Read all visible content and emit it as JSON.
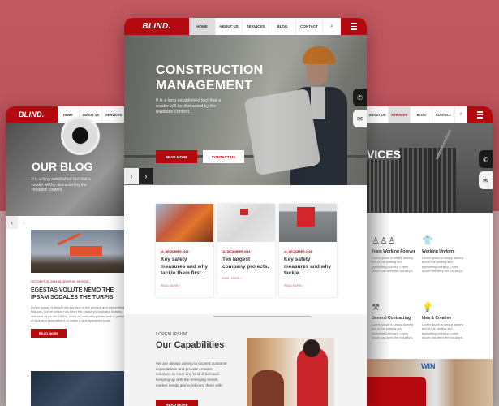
{
  "brand": {
    "logo": "BLIND.",
    "accent": "#b3090f"
  },
  "center": {
    "nav": {
      "items": [
        {
          "label": "HOME",
          "active": true
        },
        {
          "label": "ABOUT US"
        },
        {
          "label": "SERVICES"
        },
        {
          "label": "BLOG"
        },
        {
          "label": "CONTACT"
        }
      ],
      "search_icon": "⌕",
      "menu_icon": "hamburger-icon"
    },
    "hero": {
      "title": "CONSTRUCTION MANAGEMENT",
      "text": "It is a long established fact that a reader will be distracted by the readable content.",
      "primary_button": "READ MORE",
      "secondary_button": "CONTACT US",
      "prev": "‹",
      "next": "›"
    },
    "side_tabs": {
      "phone": "✆",
      "mail": "✉"
    },
    "cards": [
      {
        "date": "11, DECEMBER 2018",
        "title": "Key safety measures and why tackle them first.",
        "more": "READ MORE >"
      },
      {
        "date": "11, DECEMBER 2018",
        "title": "Ten largest company projects.",
        "more": "READ MORE >"
      },
      {
        "date": "11, DECEMBER 2018",
        "title": "Key safety measures and why tackle.",
        "more": "READ MORE >"
      }
    ],
    "capabilities": {
      "label": "LOREM IPSUM",
      "title": "Our Capabilities",
      "text": "We are always aiming to exceed customer expectations and provide creative solutions to meet any kind of demand. Keeping up with the emerging trends, market needs and combining them with.",
      "button": "READ MORE"
    }
  },
  "left": {
    "nav": {
      "items": [
        {
          "label": "HOME"
        },
        {
          "label": "ABOUT US"
        },
        {
          "label": "SERVICES"
        }
      ]
    },
    "hero": {
      "title": "OUR BLOG",
      "text": "It is a long established fact that a reader will be distracted by the readable content.",
      "prev": "‹",
      "next": "›"
    },
    "post": {
      "date": "OCTOBER 5, 2018 IN GRAPHIC DESIGN",
      "title": "EGESTAS VOLUTE NEMO THE IPSAM SODALES THE TURPIS",
      "text": "Lorem Ipsum is simply dummy text of the printing and typesetting industry. Lorem Ipsum has been the industry's standard dummy text ever since the 1500s, when an unknown printer took a galley of type and scrambled it to make a type specimen book.",
      "button": "READ MORE"
    }
  },
  "right": {
    "nav": {
      "items": [
        {
          "label": "ABOUT US"
        },
        {
          "label": "SERVICES",
          "active": true
        },
        {
          "label": "BLOG"
        },
        {
          "label": "CONTACT"
        }
      ],
      "search_icon": "⌕"
    },
    "hero": {
      "title": "VICES"
    },
    "side_tabs": {
      "phone": "✆",
      "mail": "✉"
    },
    "services": [
      {
        "icon": "team-icon",
        "glyph": "♙♙♙",
        "title": "Team Working Forever",
        "text": "Lorem Ipsum is simply dummy text of the printing and typesetting industry. Lorem Ipsum has been the industry's."
      },
      {
        "icon": "tshirt-icon",
        "glyph": "👕",
        "title": "Working Uniform",
        "text": "Lorem Ipsum is simply dummy text of the printing and typesetting industry. Lorem Ipsum has been the industry's."
      },
      {
        "icon": "contracting-icon",
        "glyph": "⚒",
        "title": "General Contracting",
        "text": "Lorem Ipsum is simply dummy text of the printing and typesetting industry. Lorem Ipsum has been the industry's."
      },
      {
        "icon": "idea-icon",
        "glyph": "💡",
        "title": "Idea & Creative",
        "text": "Lorem Ipsum is simply dummy text of the printing and typesetting industry. Lorem Ipsum has been the industry's."
      }
    ],
    "bottom_sign": "WIN"
  }
}
